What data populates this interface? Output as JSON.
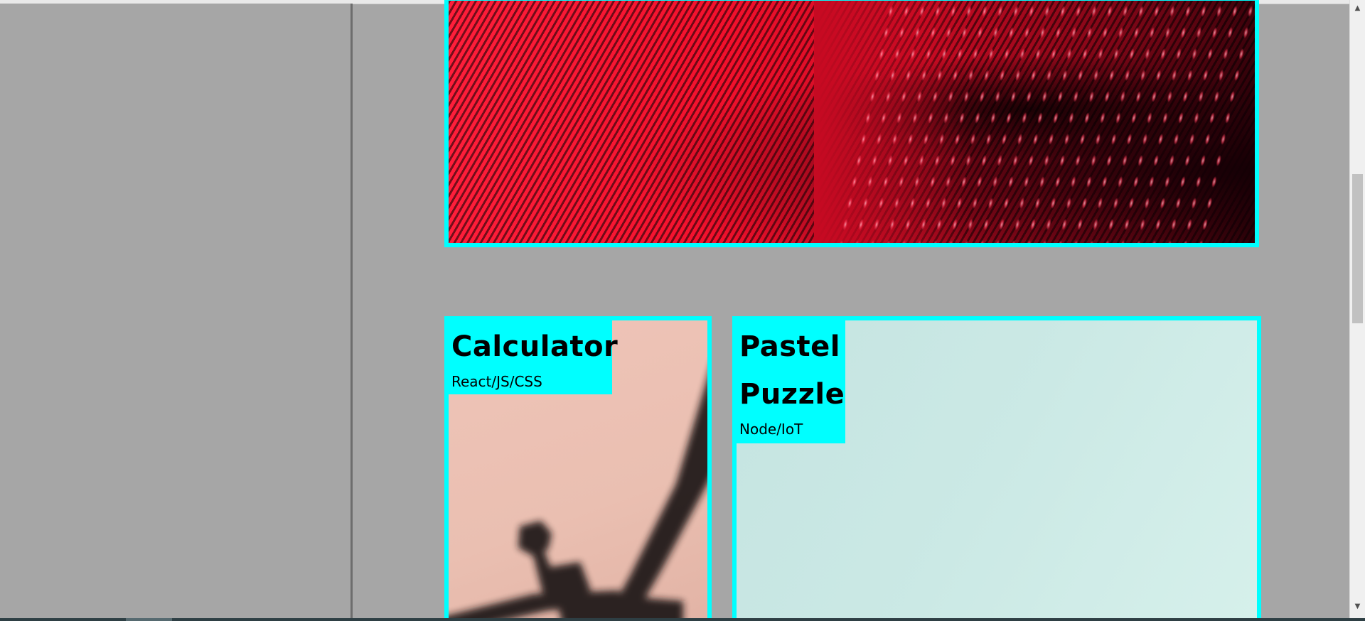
{
  "projects": [
    {
      "title": "Calculator",
      "tech": "React/JS/CSS"
    },
    {
      "title": "Pastel Puzzle",
      "tech": "Node/IoT"
    }
  ],
  "colors": {
    "card_border": "#00ffff",
    "label_background": "#00ffff",
    "page_background": "#a6a6a6",
    "sidebar_divider": "#6d6d6d"
  },
  "icons": {
    "scroll_up": "scroll-up-arrow-icon",
    "scroll_down": "scroll-down-arrow-icon"
  },
  "scrollbar": {
    "up_glyph": "▲",
    "down_glyph": "▼"
  }
}
